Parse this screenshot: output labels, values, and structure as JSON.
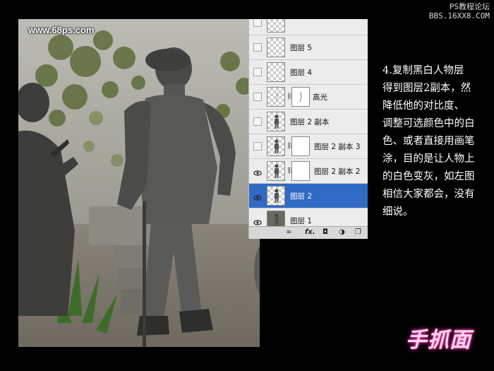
{
  "watermark": {
    "line1": "PS教程论坛",
    "line2": "BBS.16XX8.COM"
  },
  "photo": {
    "url_text": "www.68ps.com"
  },
  "layers_panel": {
    "layers": [
      {
        "name": "",
        "visible": false,
        "has_mask": false,
        "partial": true
      },
      {
        "name": "图层 5",
        "visible": false,
        "has_mask": false
      },
      {
        "name": "图层 4",
        "visible": false,
        "has_mask": false
      },
      {
        "name": "高光",
        "visible": false,
        "has_mask": true
      },
      {
        "name": "图层 2 副本",
        "visible": false,
        "has_mask": false
      },
      {
        "name": "图层 2 副本 3",
        "visible": false,
        "has_mask": true
      },
      {
        "name": "图层 2 副本 2",
        "visible": true,
        "has_mask": true
      },
      {
        "name": "图层 2",
        "visible": true,
        "has_mask": false,
        "selected": true
      },
      {
        "name": "图层 1",
        "visible": true,
        "has_mask": false
      }
    ],
    "footer_buttons": [
      "link-icon",
      "fx-icon",
      "mask-icon",
      "adjustment-icon",
      "new-layer-icon"
    ],
    "footer_fx_label": "fx."
  },
  "description": {
    "lines": [
      "4.复制黑白人物层",
      "得到图层2副本，然",
      "降低他的对比度、",
      "调整可选颜色中的白",
      "色、或者直接用画笔",
      "涂，目的是让人物上",
      "的白色变灰，如左图",
      "相信大家都会，没有",
      "细说。"
    ]
  },
  "logo": {
    "text": "手抓面"
  },
  "colors": {
    "selection": "#316ac5",
    "panel_bg": "#ececec",
    "logo_glow": "#e0209a"
  }
}
